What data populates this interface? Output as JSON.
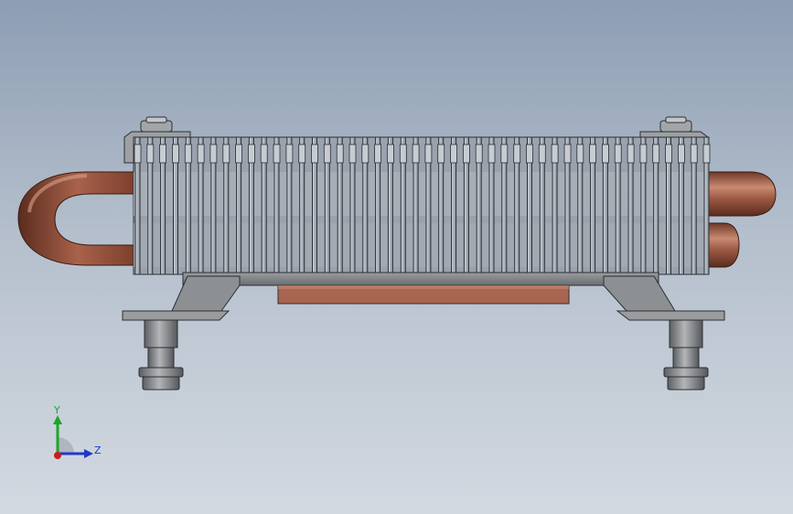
{
  "viewport": {
    "background_top": "#8d9db3",
    "background_bottom": "#d3d9e1"
  },
  "model": {
    "name": "heatsink-assembly",
    "fin_count": 46,
    "colors": {
      "pipe": "#9d5a44",
      "pipe_highlight": "#c98a72",
      "pipe_shadow": "#6e3828",
      "fin": "#b5bcc6",
      "fin_edge": "#2b2f35",
      "bracket": "#8a8c8e",
      "bracket_dark": "#5d6063",
      "plate": "#a8654f",
      "outline": "#2b2f35"
    }
  },
  "triad": {
    "y_label": "Y",
    "z_label": "Z",
    "y_color": "#1fa52a",
    "z_color": "#1d3ac8",
    "x_color": "#c81d1d"
  }
}
